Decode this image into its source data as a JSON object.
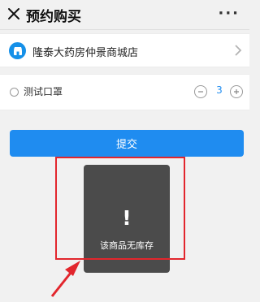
{
  "header": {
    "title": "预约购买",
    "more_label": "···"
  },
  "store": {
    "name": "隆泰大药房仲景商城店"
  },
  "product": {
    "name": "测试口罩",
    "quantity": "3"
  },
  "actions": {
    "submit_label": "提交"
  },
  "toast": {
    "icon": "!",
    "message": "该商品无库存"
  },
  "colors": {
    "accent": "#1f8cf0",
    "annotation": "#e2262d",
    "toast_bg": "#4b4b4b"
  },
  "icons": [
    "close-icon",
    "store-icon",
    "chevron-right-icon",
    "minus-icon",
    "plus-icon",
    "alert-icon",
    "arrow-icon"
  ]
}
